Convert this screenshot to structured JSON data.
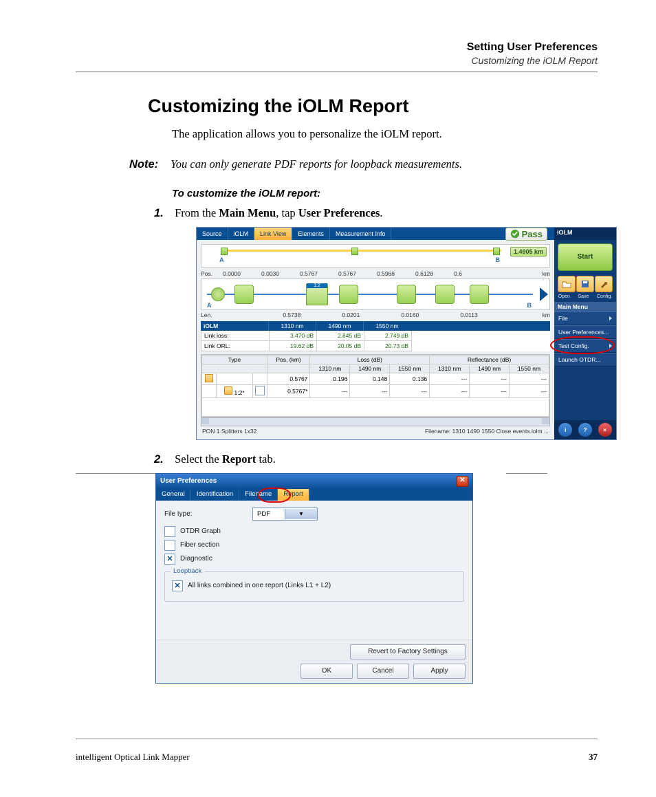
{
  "header": {
    "chapter": "Setting User Preferences",
    "section": "Customizing the iOLM Report"
  },
  "title": "Customizing the iOLM Report",
  "intro": "The application allows you to personalize the iOLM report.",
  "note": {
    "label": "Note:",
    "text": "You can only generate PDF reports for loopback measurements."
  },
  "procedure_title": "To customize the iOLM report:",
  "steps": {
    "s1_num": "1.",
    "s1_a": "From the ",
    "s1_b": "Main Menu",
    "s1_c": ", tap ",
    "s1_d": "User Preferences",
    "s1_e": ".",
    "s2_num": "2.",
    "s2_a": "Select the ",
    "s2_b": "Report",
    "s2_c": " tab."
  },
  "footer": {
    "product": "intelligent Optical Link Mapper",
    "page": "37"
  },
  "shot1": {
    "tabs": [
      "Source",
      "iOLM",
      "Link View",
      "Elements",
      "Measurement Info"
    ],
    "tabs_active_index": 2,
    "pass": "Pass",
    "ruler_km": "1.4905 km",
    "ruler_A": "A",
    "ruler_B": "B",
    "pos_label": "Pos.",
    "pos_values": [
      "0.0000",
      "0.0030",
      "0.5767",
      "0.5767",
      "0.5968",
      "0.6128",
      "0.6"
    ],
    "pos_unit": "km",
    "split_label": "1:2",
    "len_label": "Len.",
    "len_values": [
      "0.5738",
      "0.0201",
      "0.0160",
      "0.0113"
    ],
    "len_unit": "km",
    "wl_head": [
      "iOLM",
      "1310 nm",
      "1490 nm",
      "1550 nm"
    ],
    "link_loss": {
      "label": "Link loss:",
      "v": [
        "3.470 dB",
        "2.845 dB",
        "2.749 dB"
      ]
    },
    "link_orl": {
      "label": "Link ORL:",
      "v": [
        "19.62 dB",
        "20.05 dB",
        "20.73 dB"
      ]
    },
    "grid_head_top": [
      "Type",
      "Pos. (km)",
      "Loss (dB)",
      "Reflectance (dB)"
    ],
    "grid_head_sub": [
      "1310 nm",
      "1490 nm",
      "1550 nm",
      "1310 nm",
      "1490 nm",
      "1550 nm"
    ],
    "grid_rows": [
      {
        "type": "",
        "pos": "0.5767",
        "loss": [
          "0.196",
          "0.148",
          "0.136"
        ],
        "ref": [
          "---",
          "---",
          "---"
        ]
      },
      {
        "type": "1:2*",
        "pos": "0.5767*",
        "loss": [
          "---",
          "---",
          "---"
        ],
        "ref": [
          "---",
          "---",
          "---"
        ]
      }
    ],
    "status_left": "PON 1 Splitters 1x32",
    "status_right": "Filename: 1310 1490 1550 Close events.iolm ...",
    "side": {
      "brand": "iOLM",
      "start": "Start",
      "tool_labels": [
        "Open",
        "Save",
        "Config."
      ],
      "main_menu": "Main Menu",
      "items": [
        "File",
        "User Preferences...",
        "Test Config.",
        "Launch OTDR..."
      ],
      "foot_info": "i",
      "foot_help": "?",
      "foot_close": "×"
    }
  },
  "shot2": {
    "title": "User Preferences",
    "tabs": [
      "General",
      "Identification",
      "Filename",
      "Report"
    ],
    "tabs_active_index": 3,
    "file_type_label": "File type:",
    "file_type_value": "PDF",
    "checks": [
      {
        "label": "OTDR Graph",
        "checked": false
      },
      {
        "label": "Fiber section",
        "checked": false
      },
      {
        "label": "Diagnostic",
        "checked": true
      }
    ],
    "group_title": "Loopback",
    "group_check": {
      "label": "All links combined in one report (Links L1 + L2)",
      "checked": true
    },
    "btn_revert": "Revert to Factory Settings",
    "btn_ok": "OK",
    "btn_cancel": "Cancel",
    "btn_apply": "Apply"
  }
}
